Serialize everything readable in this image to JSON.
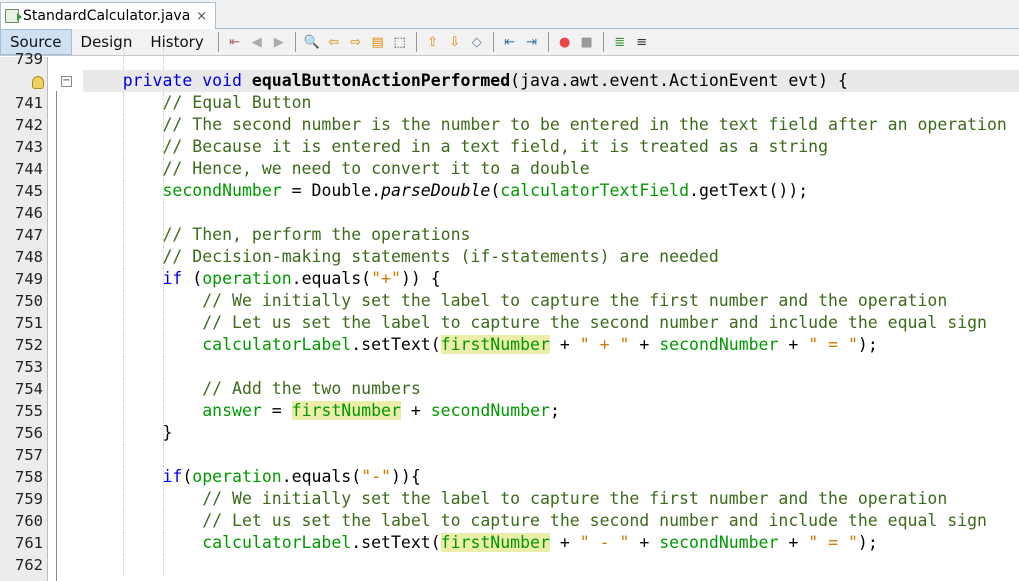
{
  "tab": {
    "title": "StandardCalculator.java",
    "close": "×"
  },
  "view_tabs": [
    {
      "label": "Source",
      "active": true
    },
    {
      "label": "Design"
    },
    {
      "label": "History"
    }
  ],
  "toolbar_icons": [
    "last-edit-icon",
    "back-icon",
    "forward-icon",
    "find-icon",
    "find-previous-icon",
    "find-next-icon",
    "toggle-highlight-icon",
    "select-rectangle-icon",
    "previous-bookmark-icon",
    "next-bookmark-icon",
    "toggle-bookmark-icon",
    "shift-left-icon",
    "shift-right-icon",
    "record-macro-icon",
    "stop-macro-icon",
    "comment-icon",
    "uncomment-icon"
  ],
  "colors": {
    "keyword": "#0000e6",
    "comment": "#3d6b1c",
    "field": "#009900",
    "string": "#ce7b00",
    "highlight": "#ecedaa"
  },
  "lines": [
    {
      "n": "739",
      "t": []
    },
    {
      "n": "",
      "hint": true,
      "cur": true,
      "t": [
        [
          "pl",
          "    "
        ],
        [
          "kw",
          "private void "
        ],
        [
          "md",
          "equalButtonActionPerformed"
        ],
        [
          "pl",
          "(java.awt.event.ActionEvent evt) {"
        ]
      ]
    },
    {
      "n": "741",
      "t": [
        [
          "pl",
          "        "
        ],
        [
          "cm",
          "// Equal Button"
        ]
      ]
    },
    {
      "n": "742",
      "t": [
        [
          "pl",
          "        "
        ],
        [
          "cm",
          "// The second number is the number to be entered in the text field after an operation"
        ]
      ]
    },
    {
      "n": "743",
      "t": [
        [
          "pl",
          "        "
        ],
        [
          "cm",
          "// Because it is entered in a text field, it is treated as a string"
        ]
      ]
    },
    {
      "n": "744",
      "t": [
        [
          "pl",
          "        "
        ],
        [
          "cm",
          "// Hence, we need to convert it to a double"
        ]
      ]
    },
    {
      "n": "745",
      "t": [
        [
          "pl",
          "        "
        ],
        [
          "fd",
          "secondNumber"
        ],
        [
          "pl",
          " = Double."
        ],
        [
          "it",
          "parseDouble"
        ],
        [
          "pl",
          "("
        ],
        [
          "fd",
          "calculatorTextField"
        ],
        [
          "pl",
          ".getText());"
        ]
      ]
    },
    {
      "n": "746",
      "t": []
    },
    {
      "n": "747",
      "t": [
        [
          "pl",
          "        "
        ],
        [
          "cm",
          "// Then, perform the operations"
        ]
      ]
    },
    {
      "n": "748",
      "t": [
        [
          "pl",
          "        "
        ],
        [
          "cm",
          "// Decision-making statements (if-statements) are needed"
        ]
      ]
    },
    {
      "n": "749",
      "t": [
        [
          "pl",
          "        "
        ],
        [
          "kw",
          "if"
        ],
        [
          "pl",
          " ("
        ],
        [
          "fd",
          "operation"
        ],
        [
          "pl",
          ".equals("
        ],
        [
          "st",
          "\"+\""
        ],
        [
          "pl",
          ")) {"
        ]
      ]
    },
    {
      "n": "750",
      "t": [
        [
          "pl",
          "            "
        ],
        [
          "cm",
          "// We initially set the label to capture the first number and the operation"
        ]
      ]
    },
    {
      "n": "751",
      "t": [
        [
          "pl",
          "            "
        ],
        [
          "cm",
          "// Let us set the label to capture the second number and include the equal sign"
        ]
      ]
    },
    {
      "n": "752",
      "t": [
        [
          "pl",
          "            "
        ],
        [
          "fd",
          "calculatorLabel"
        ],
        [
          "pl",
          ".setText("
        ],
        [
          "fd hl",
          "firstNumber"
        ],
        [
          "pl",
          " + "
        ],
        [
          "st",
          "\" + \""
        ],
        [
          "pl",
          " + "
        ],
        [
          "fd",
          "secondNumber"
        ],
        [
          "pl",
          " + "
        ],
        [
          "st",
          "\" = \""
        ],
        [
          "pl",
          ");"
        ]
      ]
    },
    {
      "n": "753",
      "t": []
    },
    {
      "n": "754",
      "t": [
        [
          "pl",
          "            "
        ],
        [
          "cm",
          "// Add the two numbers"
        ]
      ]
    },
    {
      "n": "755",
      "t": [
        [
          "pl",
          "            "
        ],
        [
          "fd",
          "answer"
        ],
        [
          "pl",
          " = "
        ],
        [
          "fd hl",
          "firstNumber"
        ],
        [
          "pl",
          " + "
        ],
        [
          "fd",
          "secondNumber"
        ],
        [
          "pl",
          ";"
        ]
      ]
    },
    {
      "n": "756",
      "t": [
        [
          "pl",
          "        }"
        ]
      ]
    },
    {
      "n": "757",
      "t": []
    },
    {
      "n": "758",
      "t": [
        [
          "pl",
          "        "
        ],
        [
          "kw",
          "if"
        ],
        [
          "pl",
          "("
        ],
        [
          "fd",
          "operation"
        ],
        [
          "pl",
          ".equals("
        ],
        [
          "st",
          "\"-\""
        ],
        [
          "pl",
          ")){"
        ]
      ]
    },
    {
      "n": "759",
      "t": [
        [
          "pl",
          "            "
        ],
        [
          "cm",
          "// We initially set the label to capture the first number and the operation"
        ]
      ]
    },
    {
      "n": "760",
      "t": [
        [
          "pl",
          "            "
        ],
        [
          "cm",
          "// Let us set the label to capture the second number and include the equal sign"
        ]
      ]
    },
    {
      "n": "761",
      "t": [
        [
          "pl",
          "            "
        ],
        [
          "fd",
          "calculatorLabel"
        ],
        [
          "pl",
          ".setText("
        ],
        [
          "fd hl",
          "firstNumber"
        ],
        [
          "pl",
          " + "
        ],
        [
          "st",
          "\" - \""
        ],
        [
          "pl",
          " + "
        ],
        [
          "fd",
          "secondNumber"
        ],
        [
          "pl",
          " + "
        ],
        [
          "st",
          "\" = \""
        ],
        [
          "pl",
          ");"
        ]
      ]
    },
    {
      "n": "762",
      "t": []
    }
  ]
}
